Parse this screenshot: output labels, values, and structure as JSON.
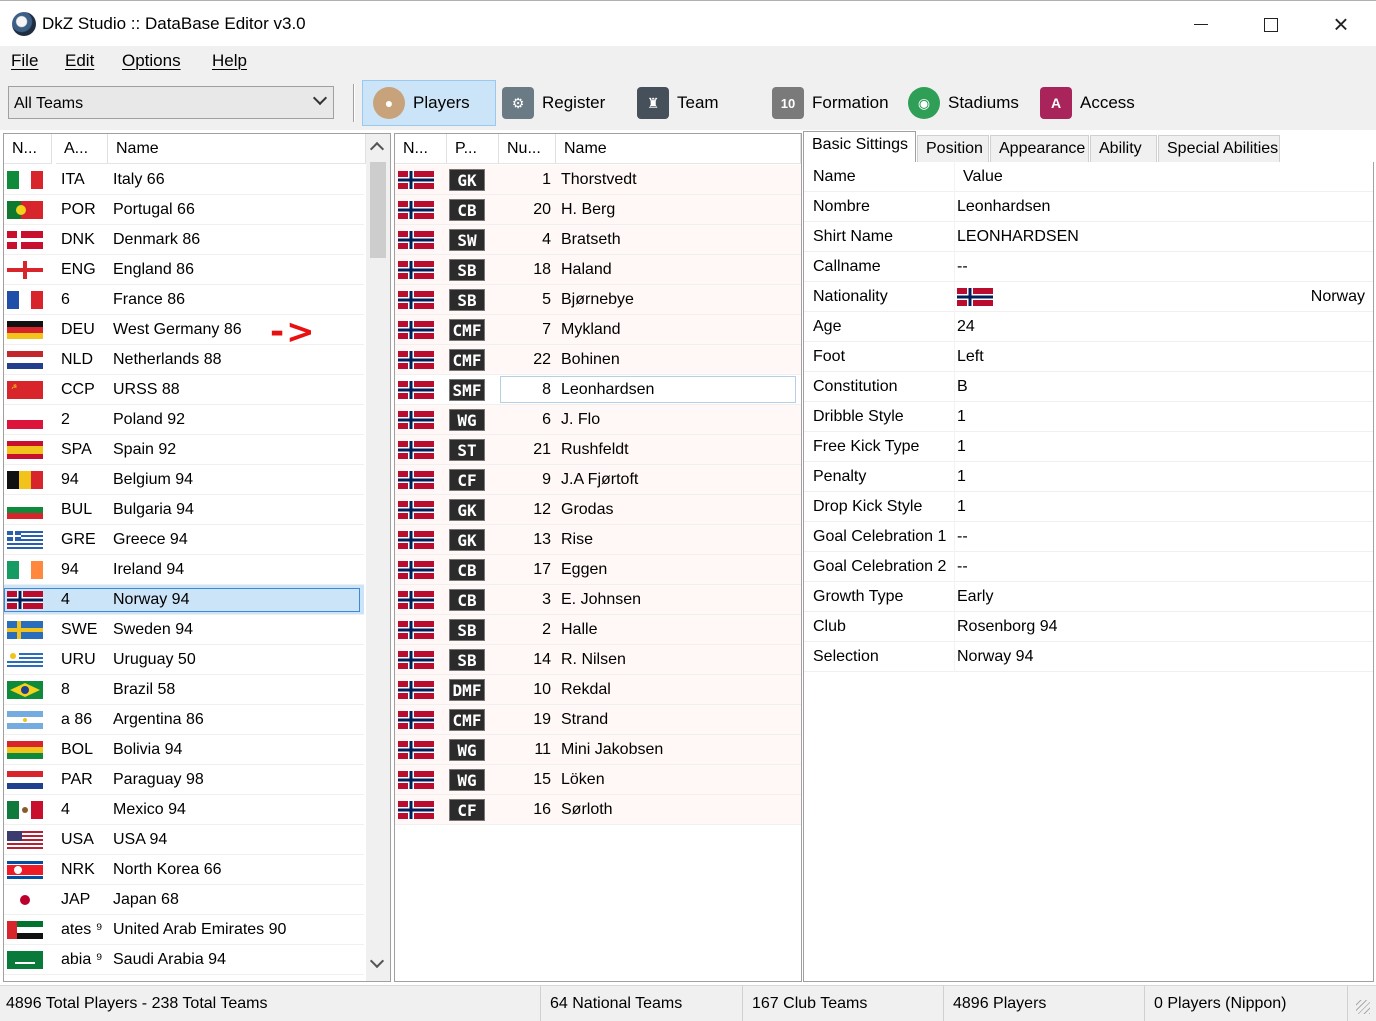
{
  "window": {
    "title": "DkZ Studio :: DataBase Editor v3.0"
  },
  "menu": [
    "File",
    "Edit",
    "Options",
    "Help"
  ],
  "toolbar": {
    "filter_value": "All Teams",
    "buttons": [
      {
        "label": "Players",
        "icon": "player-icon",
        "active": true
      },
      {
        "label": "Register",
        "icon": "register-icon",
        "active": false
      },
      {
        "label": "Team",
        "icon": "team-icon",
        "active": false
      },
      {
        "label": "Formation",
        "icon": "formation-icon",
        "active": false
      },
      {
        "label": "Stadiums",
        "icon": "stadium-icon",
        "active": false
      },
      {
        "label": "Access",
        "icon": "access-icon",
        "active": false
      }
    ]
  },
  "teams_panel": {
    "headers": [
      "N...",
      "A...",
      "Name"
    ],
    "rows": [
      {
        "abbr": "ITA",
        "name": "Italy 66",
        "flag": "ita"
      },
      {
        "abbr": "POR",
        "name": "Portugal 66",
        "flag": "por"
      },
      {
        "abbr": "DNK",
        "name": "Denmark 86",
        "flag": "dnk"
      },
      {
        "abbr": "ENG",
        "name": "England 86",
        "flag": "eng"
      },
      {
        "abbr": "6",
        "name": "France 86",
        "flag": "fra"
      },
      {
        "abbr": "DEU",
        "name": "West Germany 86",
        "flag": "deu"
      },
      {
        "abbr": "NLD",
        "name": "Netherlands 88",
        "flag": "nld"
      },
      {
        "abbr": "CCP",
        "name": "URSS 88",
        "flag": "urs"
      },
      {
        "abbr": "2",
        "name": "Poland 92",
        "flag": "pol"
      },
      {
        "abbr": "SPA",
        "name": "Spain 92",
        "flag": "spa"
      },
      {
        "abbr": "94",
        "name": "Belgium 94",
        "flag": "bel"
      },
      {
        "abbr": "BUL",
        "name": "Bulgaria 94",
        "flag": "bul"
      },
      {
        "abbr": "GRE",
        "name": "Greece 94",
        "flag": "gre"
      },
      {
        "abbr": "94",
        "name": "Ireland 94",
        "flag": "irl"
      },
      {
        "abbr": "4",
        "name": "Norway 94",
        "flag": "nor",
        "selected": true
      },
      {
        "abbr": "SWE",
        "name": "Sweden 94",
        "flag": "swe"
      },
      {
        "abbr": "URU",
        "name": "Uruguay 50",
        "flag": "uru"
      },
      {
        "abbr": "8",
        "name": "Brazil 58",
        "flag": "bra"
      },
      {
        "abbr": "a 86",
        "name": "Argentina 86",
        "flag": "arg"
      },
      {
        "abbr": "BOL",
        "name": "Bolivia 94",
        "flag": "bol"
      },
      {
        "abbr": "PAR",
        "name": "Paraguay 98",
        "flag": "par"
      },
      {
        "abbr": "4",
        "name": "Mexico 94",
        "flag": "mex"
      },
      {
        "abbr": "USA",
        "name": "USA 94",
        "flag": "usa"
      },
      {
        "abbr": "NRK",
        "name": "North Korea 66",
        "flag": "prk"
      },
      {
        "abbr": "JAP",
        "name": "Japan 68",
        "flag": "jpn"
      },
      {
        "abbr": "ates ⁹",
        "name": "United Arab Emirates 90",
        "flag": "uae"
      },
      {
        "abbr": "abia ⁹",
        "name": "Saudi Arabia 94",
        "flag": "ksa"
      }
    ]
  },
  "annotation_arrow": "->",
  "players_panel": {
    "headers": [
      "N...",
      "P...",
      "Nu...",
      "Name"
    ],
    "rows": [
      {
        "pos": "GK",
        "num": "1",
        "name": "Thorstvedt"
      },
      {
        "pos": "CB",
        "num": "20",
        "name": "H. Berg"
      },
      {
        "pos": "SW",
        "num": "4",
        "name": "Bratseth"
      },
      {
        "pos": "SB",
        "num": "18",
        "name": "Haland"
      },
      {
        "pos": "SB",
        "num": "5",
        "name": "Bjørnebye"
      },
      {
        "pos": "CMF",
        "num": "7",
        "name": "Mykland"
      },
      {
        "pos": "CMF",
        "num": "22",
        "name": "Bohinen"
      },
      {
        "pos": "SMF",
        "num": "8",
        "name": "Leonhardsen",
        "selected": true
      },
      {
        "pos": "WG",
        "num": "6",
        "name": "J. Flo"
      },
      {
        "pos": "ST",
        "num": "21",
        "name": "Rushfeldt"
      },
      {
        "pos": "CF",
        "num": "9",
        "name": "J.A Fjørtoft"
      },
      {
        "pos": "GK",
        "num": "12",
        "name": "Grodas"
      },
      {
        "pos": "GK",
        "num": "13",
        "name": "Rise"
      },
      {
        "pos": "CB",
        "num": "17",
        "name": "Eggen"
      },
      {
        "pos": "CB",
        "num": "3",
        "name": "E. Johnsen"
      },
      {
        "pos": "SB",
        "num": "2",
        "name": "Halle"
      },
      {
        "pos": "SB",
        "num": "14",
        "name": "R. Nilsen"
      },
      {
        "pos": "DMF",
        "num": "10",
        "name": "Rekdal"
      },
      {
        "pos": "CMF",
        "num": "19",
        "name": "Strand"
      },
      {
        "pos": "WG",
        "num": "11",
        "name": "Mini Jakobsen"
      },
      {
        "pos": "WG",
        "num": "15",
        "name": "Löken"
      },
      {
        "pos": "CF",
        "num": "16",
        "name": "Sørloth"
      }
    ]
  },
  "details": {
    "tabs": [
      "Basic Sittings",
      "Position",
      "Appearance",
      "Ability",
      "Special Abilities"
    ],
    "header": {
      "label": "Name",
      "value": "Value"
    },
    "rows": [
      {
        "label": "Nombre",
        "value": "Leonhardsen"
      },
      {
        "label": "Shirt Name",
        "value": "LEONHARDSEN"
      },
      {
        "label": "Callname",
        "value": "--"
      },
      {
        "label": "Nationality",
        "value": "Norway",
        "flag": "nor"
      },
      {
        "label": "Age",
        "value": "24"
      },
      {
        "label": "Foot",
        "value": "Left"
      },
      {
        "label": "Constitution",
        "value": "B"
      },
      {
        "label": "Dribble Style",
        "value": "1"
      },
      {
        "label": "Free Kick Type",
        "value": "1"
      },
      {
        "label": "Penalty",
        "value": "1"
      },
      {
        "label": "Drop Kick Style",
        "value": "1"
      },
      {
        "label": "Goal Celebration 1",
        "value": "--"
      },
      {
        "label": "Goal Celebration 2",
        "value": "--"
      },
      {
        "label": "Growth Type",
        "value": "Early"
      },
      {
        "label": "Club",
        "value": "Rosenborg 94"
      },
      {
        "label": "Selection",
        "value": "Norway 94"
      }
    ]
  },
  "status": [
    "4896 Total Players  -  238 Total Teams",
    "64 National Teams",
    "167 Club Teams",
    "4896 Players",
    "0 Players (Nippon)"
  ]
}
